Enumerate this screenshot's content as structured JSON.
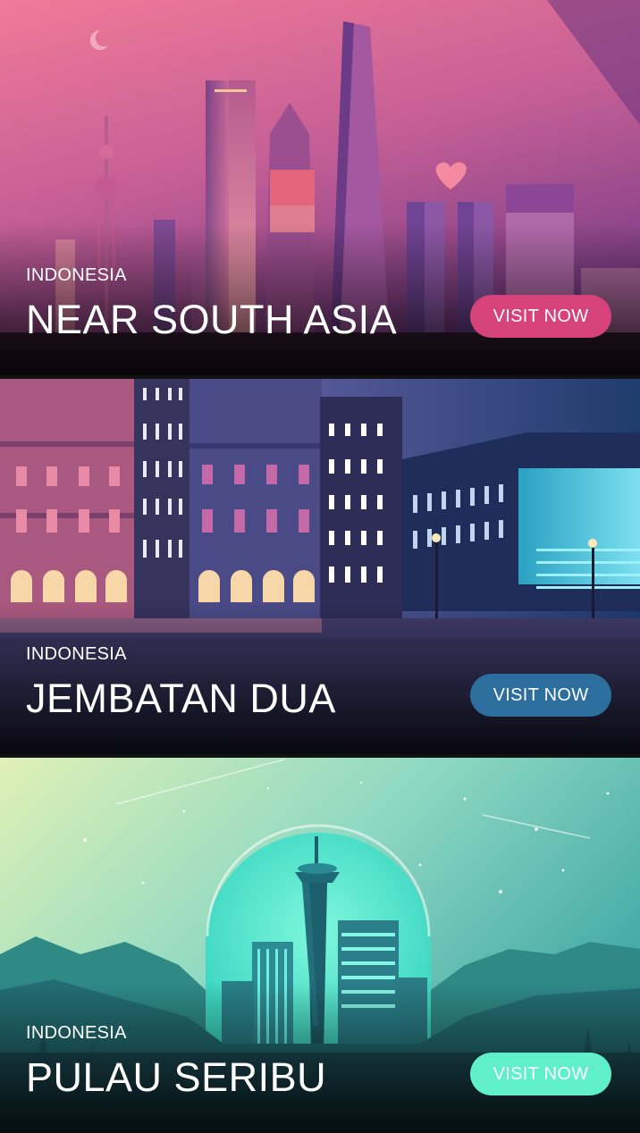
{
  "destinations": [
    {
      "country": "INDONESIA",
      "title": "NEAR SOUTH ASIA",
      "button_label": "VISIT NOW",
      "button_color": "#d6427a",
      "illustration": "pink-skyline-with-heart"
    },
    {
      "country": "INDONESIA",
      "title": "JEMBATAN DUA",
      "button_label": "VISIT NOW",
      "button_color": "#2c6e9e",
      "illustration": "night-city-street"
    },
    {
      "country": "INDONESIA",
      "title": "PULAU SERIBU",
      "button_label": "VISIT NOW",
      "button_color": "#5ff0c9",
      "illustration": "teal-tower-moon-forest"
    }
  ]
}
